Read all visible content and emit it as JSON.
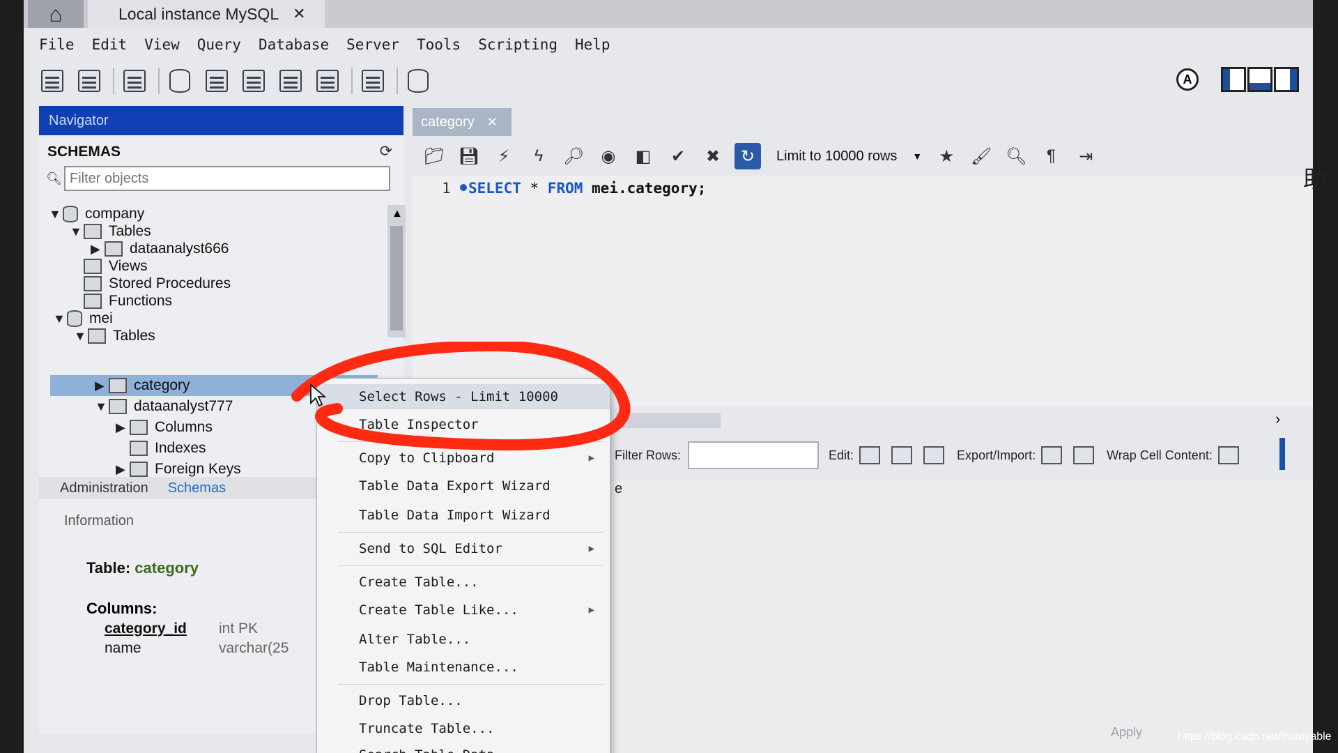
{
  "window": {
    "tab_title": "Local instance MySQL",
    "tab_close": "✕"
  },
  "menubar": [
    "File",
    "Edit",
    "View",
    "Query",
    "Database",
    "Server",
    "Tools",
    "Scripting",
    "Help"
  ],
  "navigator": {
    "header": "Navigator",
    "section_title": "SCHEMAS",
    "filter_placeholder": "Filter objects",
    "tree": [
      {
        "label": "company"
      },
      {
        "label": "Tables"
      },
      {
        "label": "dataanalyst666"
      },
      {
        "label": "Views"
      },
      {
        "label": "Stored Procedures"
      },
      {
        "label": "Functions"
      },
      {
        "label": "mei"
      },
      {
        "label": "Tables"
      },
      {
        "label": "category"
      },
      {
        "label": "dataanalyst777"
      },
      {
        "label": "Columns"
      },
      {
        "label": "Indexes"
      },
      {
        "label": "Foreign Keys"
      }
    ],
    "bottom_tabs": [
      "Administration",
      "Schemas"
    ],
    "info_header": "Information",
    "info": {
      "table_label": "Table:",
      "table_name": "category",
      "columns_label": "Columns:",
      "columns": [
        {
          "name": "category_id",
          "type": "int PK"
        },
        {
          "name": "name",
          "type": "varchar(25"
        }
      ]
    }
  },
  "editor": {
    "tab_label": "category",
    "tab_close": "✕",
    "limit_label": "Limit to 10000 rows",
    "line_number": "1",
    "code": {
      "kw1": "SELECT",
      "mid": " * ",
      "kw2": "FROM",
      "rest": " mei.category;"
    }
  },
  "result_bar": {
    "filter_label": "Filter Rows:",
    "edit_label": "Edit:",
    "export_label": "Export/Import:",
    "wrap_label": "Wrap Cell Content:",
    "cell_fragment": "e",
    "apply_label": "Apply"
  },
  "context_menu": {
    "items": [
      {
        "label": "Select Rows - Limit 10000",
        "sub": false
      },
      {
        "label": "Table Inspector",
        "sub": false
      },
      {
        "label": "Copy to Clipboard",
        "sub": true
      },
      {
        "label": "Table Data Export Wizard",
        "sub": false
      },
      {
        "label": "Table Data Import Wizard",
        "sub": false
      },
      {
        "label": "Send to SQL Editor",
        "sub": true
      },
      {
        "label": "Create Table...",
        "sub": false
      },
      {
        "label": "Create Table Like...",
        "sub": true
      },
      {
        "label": "Alter Table...",
        "sub": false
      },
      {
        "label": "Table Maintenance...",
        "sub": false
      },
      {
        "label": "Drop Table...",
        "sub": false
      },
      {
        "label": "Truncate Table...",
        "sub": false
      },
      {
        "label": "Search Table Data...",
        "sub": false
      }
    ]
  },
  "watermark": "https://blog.csdn.net/lncroyable",
  "side_text": "助",
  "colors": {
    "annotation": "#ff2a12",
    "accent": "#0f3fb3",
    "selection": "#8fb0d8"
  }
}
